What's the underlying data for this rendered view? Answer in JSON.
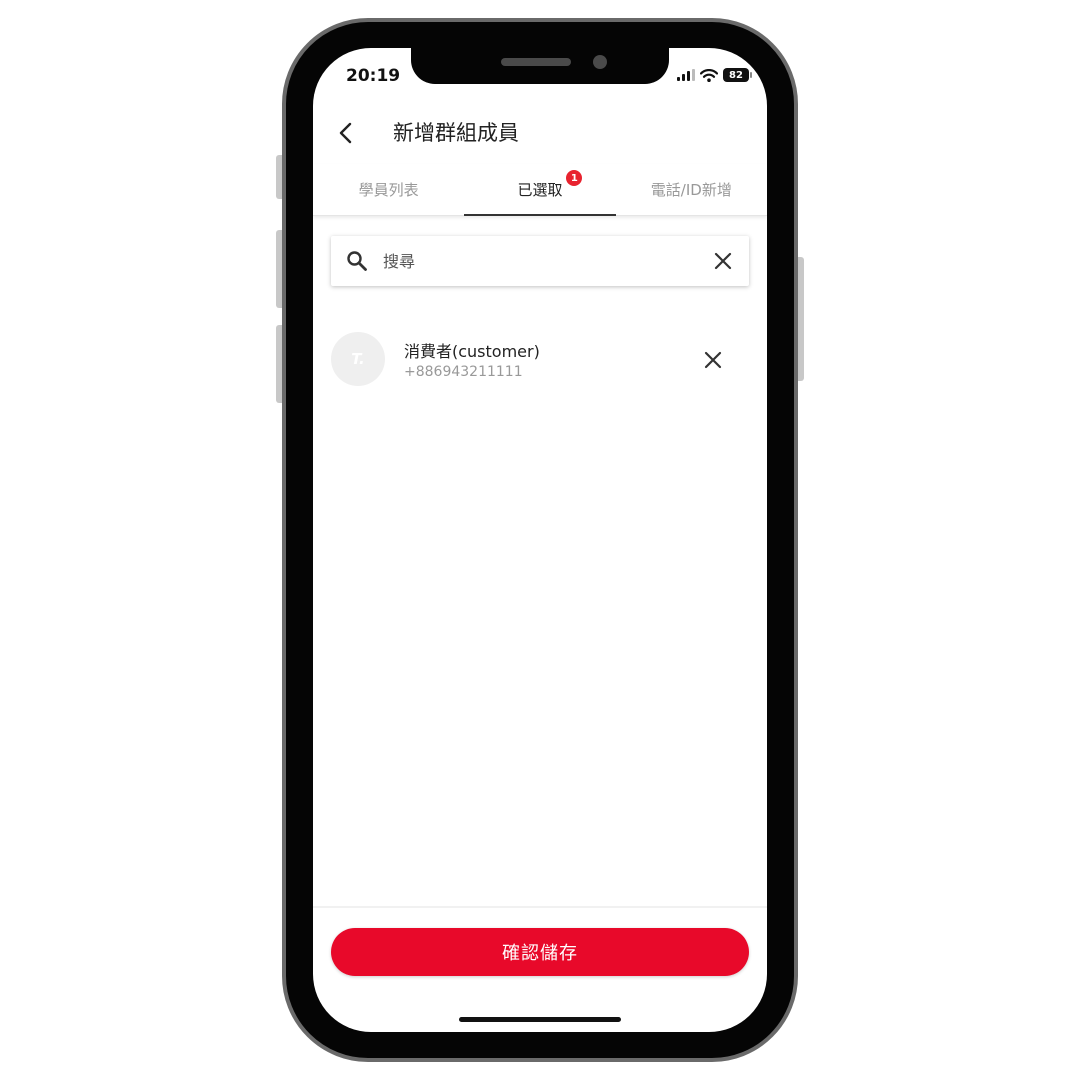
{
  "status_bar": {
    "time": "20:19",
    "battery": "82"
  },
  "header": {
    "title": "新增群組成員"
  },
  "tabs": [
    {
      "label": "學員列表",
      "active": false
    },
    {
      "label": "已選取",
      "active": true,
      "badge": "1"
    },
    {
      "label": "電話/ID新增",
      "active": false
    }
  ],
  "search": {
    "placeholder": "搜尋",
    "value": ""
  },
  "members": [
    {
      "name": "消費者(customer)",
      "phone": "+886943211111",
      "avatar_text": "T."
    }
  ],
  "footer": {
    "save_label": "確認儲存"
  },
  "colors": {
    "accent": "#e8092a",
    "badge": "#e8232f"
  }
}
